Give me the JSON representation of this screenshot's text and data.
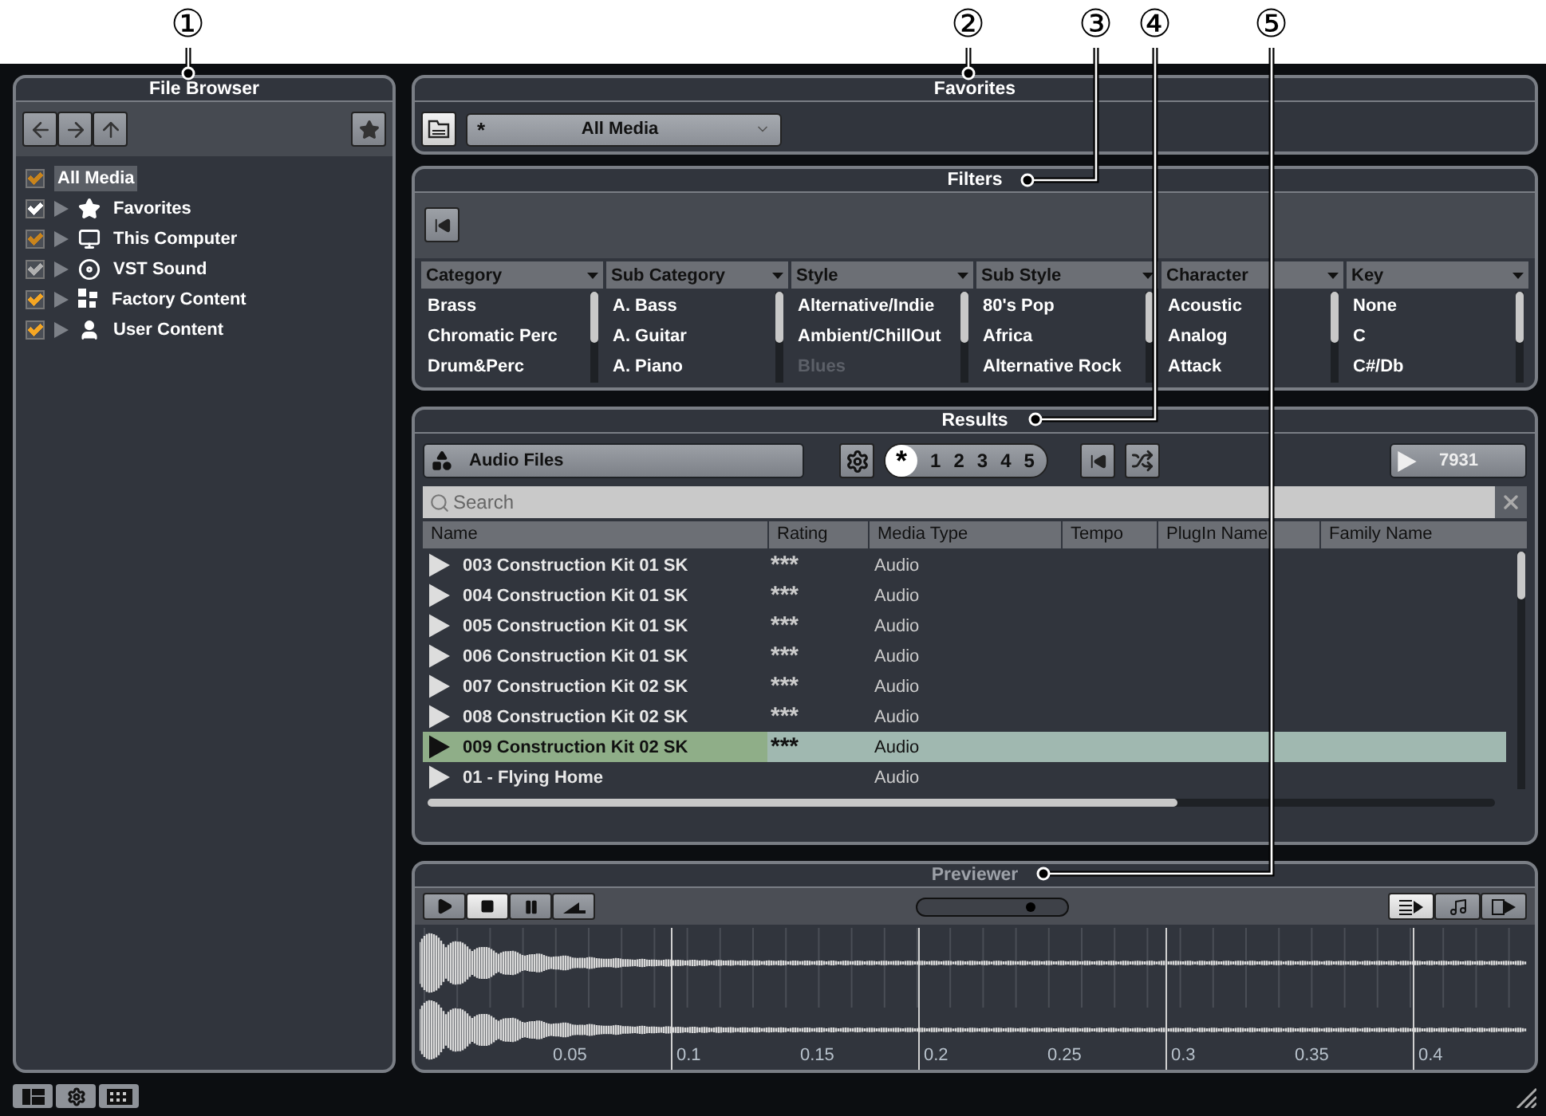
{
  "callouts": [
    "①",
    "②",
    "③",
    "④",
    "⑤"
  ],
  "file_browser": {
    "title": "File Browser",
    "tree": [
      {
        "label": "All Media",
        "checked": true,
        "color": "#c9841c",
        "selected": true,
        "children": [
          {
            "label": "Favorites",
            "kind": "star",
            "checked": true,
            "color": "#ffffff",
            "selected": false,
            "expanded": false
          },
          {
            "label": "This Computer",
            "kind": "computer",
            "checked": true,
            "color": "#c9841c",
            "selected": false,
            "expanded": false
          },
          {
            "label": "VST Sound",
            "kind": "disc",
            "checked": true,
            "color": "#b0b0b0",
            "selected": false,
            "expanded": false
          },
          {
            "label": "Factory Content",
            "kind": "factory",
            "checked": true,
            "color": "#f5a623",
            "selected": false,
            "expanded": false
          },
          {
            "label": "User Content",
            "kind": "user",
            "checked": true,
            "color": "#f5a623",
            "selected": false,
            "expanded": false
          }
        ]
      }
    ]
  },
  "favorites": {
    "title": "Favorites",
    "preset": {
      "marker": "*",
      "value": "All Media"
    }
  },
  "filters": {
    "title": "Filters",
    "columns": [
      {
        "header": "Category",
        "items": [
          {
            "label": "Brass",
            "disabled": false
          },
          {
            "label": "Chromatic Perc",
            "disabled": false
          },
          {
            "label": "Drum&Perc",
            "disabled": false
          }
        ]
      },
      {
        "header": "Sub Category",
        "items": [
          {
            "label": "A. Bass",
            "disabled": false
          },
          {
            "label": "A. Guitar",
            "disabled": false
          },
          {
            "label": "A. Piano",
            "disabled": false
          }
        ]
      },
      {
        "header": "Style",
        "items": [
          {
            "label": "Alternative/Indie",
            "disabled": false
          },
          {
            "label": "Ambient/ChillOut",
            "disabled": false
          },
          {
            "label": "Blues",
            "disabled": true
          }
        ]
      },
      {
        "header": "Sub Style",
        "items": [
          {
            "label": "80's Pop",
            "disabled": false
          },
          {
            "label": "Africa",
            "disabled": false
          },
          {
            "label": "Alternative Rock",
            "disabled": false
          }
        ]
      },
      {
        "header": "Character",
        "items": [
          {
            "label": "Acoustic",
            "disabled": false
          },
          {
            "label": "Analog",
            "disabled": false
          },
          {
            "label": "Attack",
            "disabled": false
          }
        ]
      },
      {
        "header": "Key",
        "items": [
          {
            "label": "None",
            "disabled": false
          },
          {
            "label": "C",
            "disabled": false
          },
          {
            "label": "C#/Db",
            "disabled": false
          }
        ]
      }
    ]
  },
  "results": {
    "title": "Results",
    "media_filter": "Audio Files",
    "rating_filter": [
      {
        "label": "*",
        "selected": true
      },
      {
        "label": "1",
        "selected": false
      },
      {
        "label": "2",
        "selected": false
      },
      {
        "label": "3",
        "selected": false
      },
      {
        "label": "4",
        "selected": false
      },
      {
        "label": "5",
        "selected": false
      }
    ],
    "count": "7931",
    "search": {
      "placeholder": "Search"
    },
    "columns": [
      "Name",
      "Rating",
      "Media Type",
      "Tempo",
      "PlugIn Name",
      "Family Name"
    ],
    "rows": [
      {
        "name": "003 Construction Kit 01 SK",
        "rating": "***",
        "media_type": "Audio",
        "selected": false
      },
      {
        "name": "004 Construction Kit 01 SK",
        "rating": "***",
        "media_type": "Audio",
        "selected": false
      },
      {
        "name": "005 Construction Kit 01 SK",
        "rating": "***",
        "media_type": "Audio",
        "selected": false
      },
      {
        "name": "006 Construction Kit 01 SK",
        "rating": "***",
        "media_type": "Audio",
        "selected": false
      },
      {
        "name": "007 Construction Kit 02 SK",
        "rating": "***",
        "media_type": "Audio",
        "selected": false
      },
      {
        "name": "008 Construction Kit 02 SK",
        "rating": "***",
        "media_type": "Audio",
        "selected": false
      },
      {
        "name": "009 Construction Kit 02 SK",
        "rating": "***",
        "media_type": "Audio",
        "selected": true
      },
      {
        "name": "01 - Flying Home",
        "media_type": "Audio",
        "selected": false
      }
    ]
  },
  "previewer": {
    "title": "Previewer",
    "level": 0.76,
    "ruler": [
      "0.05",
      "0.1",
      "0.15",
      "0.2",
      "0.25",
      "0.3",
      "0.35",
      "0.4"
    ]
  }
}
